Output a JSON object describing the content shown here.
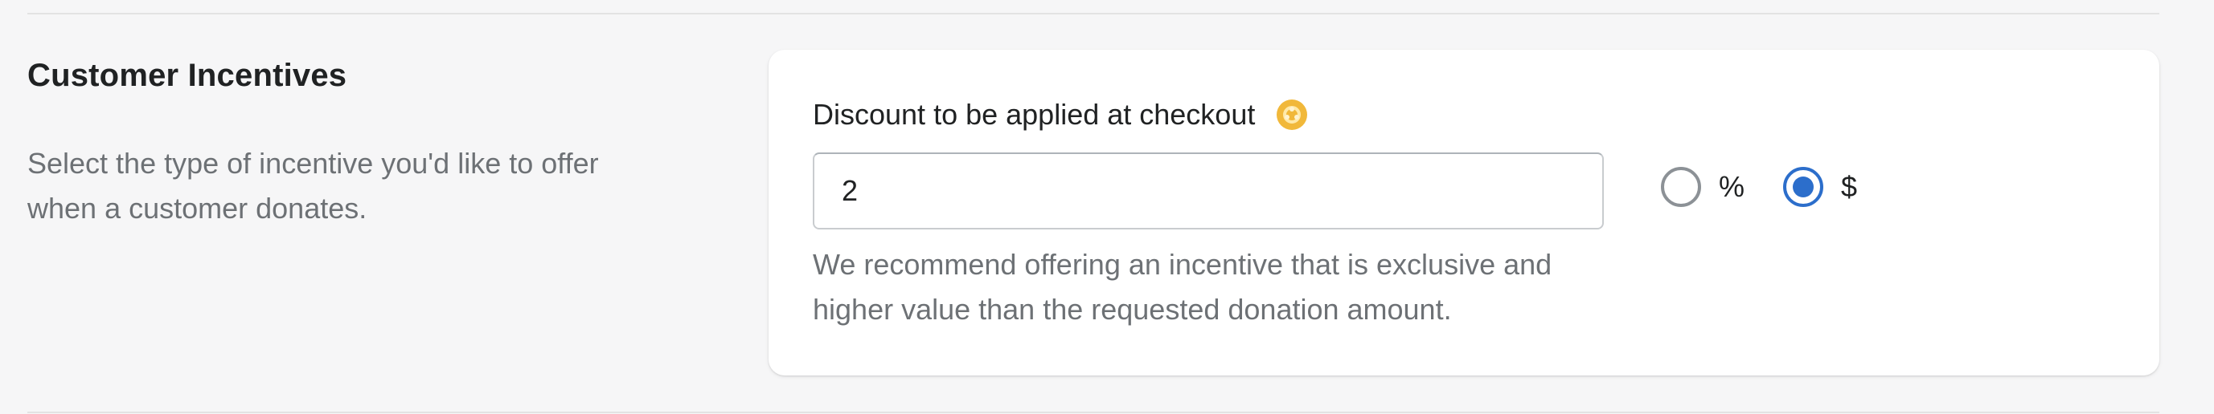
{
  "section": {
    "title": "Customer Incentives",
    "description": "Select the type of incentive you'd like to offer when a customer donates."
  },
  "discount_field": {
    "label": "Discount to be applied at checkout",
    "help_icon": "help-circle-icon",
    "value": "2",
    "help_text": "We recommend offering an incentive that is exclusive and higher value than the requested donation amount."
  },
  "discount_type": {
    "options": [
      {
        "label": "%",
        "selected": false
      },
      {
        "label": "$",
        "selected": true
      }
    ]
  },
  "colors": {
    "accent": "#2c6ecb",
    "help_icon": "#f1b83a",
    "background": "#f6f6f7"
  }
}
